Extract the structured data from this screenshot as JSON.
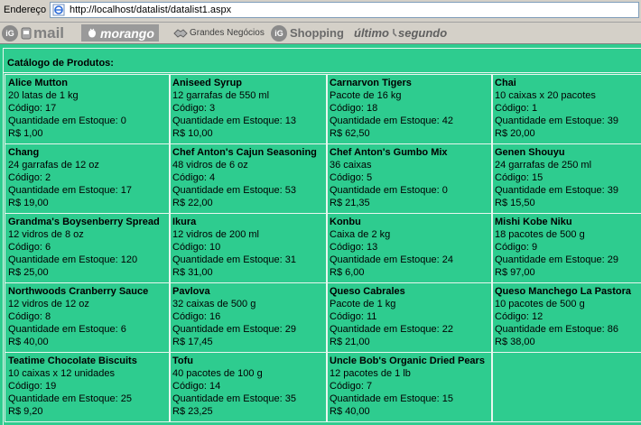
{
  "browser": {
    "address_label": "Endereço",
    "url": "http://localhost/datalist/datalist1.aspx",
    "links": {
      "ig_mail": "mail",
      "morango": "morango",
      "grandes_negocios": "Grandes Negócios",
      "ig_shopping": "Shopping",
      "ultimo_segundo_a": "último",
      "ultimo_segundo_b": "segundo",
      "ig_badge": "iG"
    }
  },
  "catalog": {
    "title": "Catálogo de Produtos:",
    "products": [
      {
        "name": "Alice Mutton",
        "qty_desc": "20 latas de 1 kg",
        "code": "Código: 17",
        "stock": "Quantidade em Estoque: 0",
        "price": "R$ 1,00"
      },
      {
        "name": "Aniseed Syrup",
        "qty_desc": "12 garrafas de 550 ml",
        "code": "Código: 3",
        "stock": "Quantidade em Estoque: 13",
        "price": "R$ 10,00"
      },
      {
        "name": "Carnarvon Tigers",
        "qty_desc": "Pacote de 16 kg",
        "code": "Código: 18",
        "stock": "Quantidade em Estoque: 42",
        "price": "R$ 62,50"
      },
      {
        "name": "Chai",
        "qty_desc": "10 caixas x 20 pacotes",
        "code": "Código: 1",
        "stock": "Quantidade em Estoque: 39",
        "price": "R$ 20,00"
      },
      {
        "name": "Chang",
        "qty_desc": "24 garrafas de 12 oz",
        "code": "Código: 2",
        "stock": "Quantidade em Estoque: 17",
        "price": "R$ 19,00"
      },
      {
        "name": "Chef Anton's Cajun Seasoning",
        "qty_desc": "48 vidros de 6 oz",
        "code": "Código: 4",
        "stock": "Quantidade em Estoque: 53",
        "price": "R$ 22,00"
      },
      {
        "name": "Chef Anton's Gumbo Mix",
        "qty_desc": "36 caixas",
        "code": "Código: 5",
        "stock": "Quantidade em Estoque: 0",
        "price": "R$ 21,35"
      },
      {
        "name": "Genen Shouyu",
        "qty_desc": "24 garrafas de 250 ml",
        "code": "Código: 15",
        "stock": "Quantidade em Estoque: 39",
        "price": "R$ 15,50"
      },
      {
        "name": "Grandma's Boysenberry Spread",
        "qty_desc": "12 vidros de 8 oz",
        "code": "Código: 6",
        "stock": "Quantidade em Estoque: 120",
        "price": "R$ 25,00"
      },
      {
        "name": "Ikura",
        "qty_desc": "12 vidros de 200 ml",
        "code": "Código: 10",
        "stock": "Quantidade em Estoque: 31",
        "price": "R$ 31,00"
      },
      {
        "name": "Konbu",
        "qty_desc": "Caixa de 2 kg",
        "code": "Código: 13",
        "stock": "Quantidade em Estoque: 24",
        "price": "R$ 6,00"
      },
      {
        "name": "Mishi Kobe Niku",
        "qty_desc": "18 pacotes de 500 g",
        "code": "Código: 9",
        "stock": "Quantidade em Estoque: 29",
        "price": "R$ 97,00"
      },
      {
        "name": "Northwoods Cranberry Sauce",
        "qty_desc": "12 vidros de 12 oz",
        "code": "Código: 8",
        "stock": "Quantidade em Estoque: 6",
        "price": "R$ 40,00"
      },
      {
        "name": "Pavlova",
        "qty_desc": "32 caixas de 500 g",
        "code": "Código: 16",
        "stock": "Quantidade em Estoque: 29",
        "price": "R$ 17,45"
      },
      {
        "name": "Queso Cabrales",
        "qty_desc": "Pacote de 1 kg",
        "code": "Código: 11",
        "stock": "Quantidade em Estoque: 22",
        "price": "R$ 21,00"
      },
      {
        "name": "Queso Manchego La Pastora",
        "qty_desc": "10 pacotes de 500 g",
        "code": "Código: 12",
        "stock": "Quantidade em Estoque: 86",
        "price": "R$ 38,00"
      },
      {
        "name": "Teatime Chocolate Biscuits",
        "qty_desc": "10 caixas x 12 unidades",
        "code": "Código: 19",
        "stock": "Quantidade em Estoque: 25",
        "price": "R$ 9,20"
      },
      {
        "name": "Tofu",
        "qty_desc": "40 pacotes de 100 g",
        "code": "Código: 14",
        "stock": "Quantidade em Estoque: 35",
        "price": "R$ 23,25"
      },
      {
        "name": "Uncle Bob's Organic Dried Pears",
        "qty_desc": "12 pacotes de 1 lb",
        "code": "Código: 7",
        "stock": "Quantidade em Estoque: 15",
        "price": "R$ 40,00"
      },
      {
        "name": "",
        "qty_desc": "",
        "code": "",
        "stock": "",
        "price": ""
      }
    ]
  },
  "colors": {
    "content_bg": "#2ecc8f",
    "border": "#e8f6ee",
    "chrome": "#d4d0c8"
  }
}
